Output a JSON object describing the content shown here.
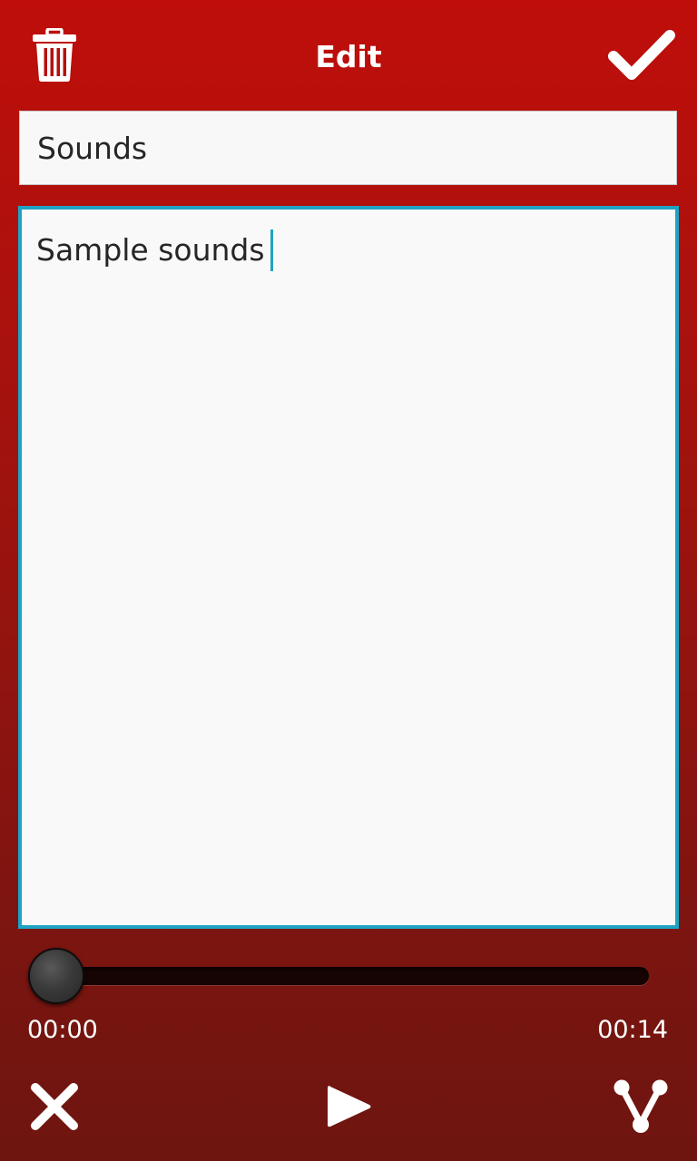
{
  "header": {
    "title": "Edit",
    "delete_icon": "trash-icon",
    "confirm_icon": "checkmark-icon"
  },
  "editor": {
    "title_value": "Sounds",
    "body_value": "Sample sounds"
  },
  "player": {
    "current_time": "00:00",
    "total_time": "00:14",
    "progress": 0,
    "close_icon": "close-icon",
    "play_icon": "play-icon",
    "share_icon": "share-icon"
  },
  "colors": {
    "background_top": "#bf0e0a",
    "background_bottom": "#6e1510",
    "focus_border": "#1fa3c5"
  }
}
